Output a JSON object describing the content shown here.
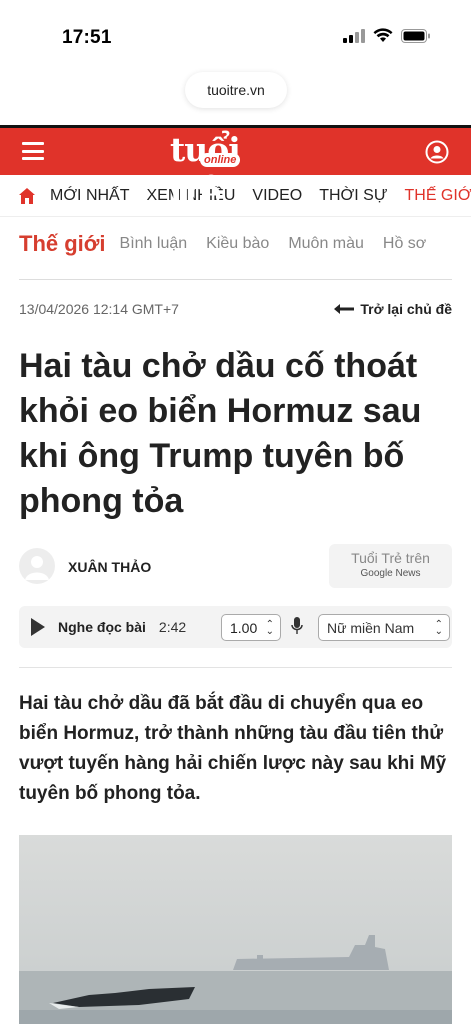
{
  "status_bar": {
    "time": "17:51"
  },
  "browser": {
    "url": "tuoitre.vn"
  },
  "header": {
    "logo_main": "tuổi trẻ",
    "logo_sub": "online"
  },
  "nav": {
    "items": [
      {
        "label": "MỚI NHẤT"
      },
      {
        "label": "XEM NHIỀU"
      },
      {
        "label": "VIDEO"
      },
      {
        "label": "THỜI SỰ"
      },
      {
        "label": "THẾ GIỚ"
      }
    ]
  },
  "category": {
    "main": "Thế giới",
    "subs": [
      "Bình luận",
      "Kiều bào",
      "Muôn màu",
      "Hồ sơ"
    ]
  },
  "article": {
    "date": "13/04/2026 12:14 GMT+7",
    "back_label": "Trở lại chủ đề",
    "title": "Hai tàu chở dầu cố thoát khỏi eo biển Hormuz sau khi ông Trump tuyên bố phong tỏa",
    "author": "XUÂN THẢO",
    "gnews_line1": "Tuổi Trẻ trên",
    "gnews_line2": "Google News",
    "sapo": "Hai tàu chở dầu đã bắt đầu di chuyển qua eo biển Hormuz, trở thành những tàu đầu tiên thử vượt tuyến hàng hải chiến lược này sau khi Mỹ tuyên bố phong tỏa."
  },
  "audio": {
    "label": "Nghe đọc bài",
    "duration": "2:42",
    "speed": "1.00",
    "voice": "Nữ miền Nam"
  },
  "colors": {
    "brand_red": "#e0332a",
    "category_red": "#d63e2f"
  },
  "icons": [
    "menu-icon",
    "user-icon",
    "home-icon",
    "arrow-left-icon",
    "play-icon",
    "mic-icon",
    "chevron-updown-icon"
  ]
}
